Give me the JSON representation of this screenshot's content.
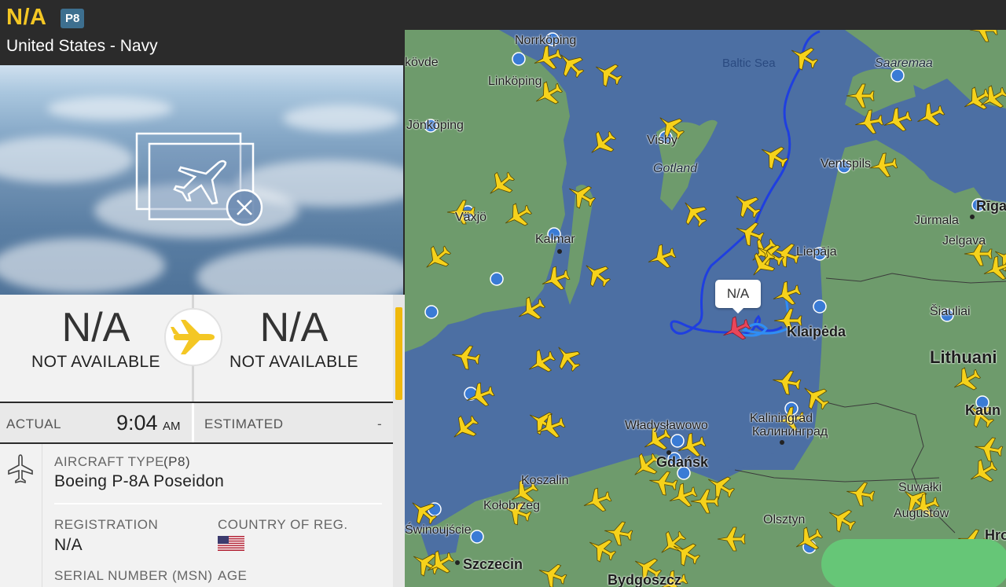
{
  "flight": {
    "callsign": "N/A",
    "aircraft_code": "P8",
    "operator": "United States - Navy"
  },
  "route": {
    "origin": {
      "code": "N/A",
      "name": "NOT AVAILABLE"
    },
    "destination": {
      "code": "N/A",
      "name": "NOT AVAILABLE"
    }
  },
  "times": {
    "actual_label": "ACTUAL",
    "actual_time": "9:04",
    "actual_ampm": "AM",
    "estimated_label": "ESTIMATED",
    "estimated_value": "-"
  },
  "details": {
    "aircraft_type_label": "AIRCRAFT TYPE",
    "aircraft_type_code": "(P8)",
    "aircraft_type_value": "Boeing P-8A Poseidon",
    "registration_label": "REGISTRATION",
    "registration_value": "N/A",
    "country_label": "COUNTRY OF REG.",
    "serial_label": "SERIAL NUMBER (MSN)",
    "age_label": "AGE"
  },
  "map": {
    "selected_callout": "N/A",
    "labels": {
      "baltic_sea": "Baltic Sea",
      "saaremaa": "Saaremaa",
      "gotland": "Gotland",
      "visby": "Visby",
      "norrkoping": "Norrköping",
      "linkoping": "Linköping",
      "jonkoping": "Jönköping",
      "kovde": "kövde",
      "vaxjo": "Växjö",
      "kalmar": "Kalmar",
      "ventspils": "Ventspils",
      "jurmala": "Jūrmala",
      "riga": "Rīga",
      "jelgava": "Jelgava",
      "liepaja": "Liepāja",
      "klaipeda": "Klaipėda",
      "siauliai": "Šiauliai",
      "lithuania": "Lithuani",
      "kaunas": "Kaun",
      "kaliningrad_lat": "Kaliningrad",
      "kaliningrad_cyr": "Калининград",
      "wladyslawowo": "Władysławowo",
      "gdansk": "Gdańsk",
      "koszalin": "Koszalin",
      "kolobrzeg": "Kołobrzeg",
      "swinoujscie": "Świnoujście",
      "szczecin": "Szczecin",
      "bydgoszcz": "Bydgoszcz",
      "olsztyn": "Olsztyn",
      "suwalki": "Suwałki",
      "augustow": "Augustów",
      "hrodna": "Hrod"
    }
  },
  "colors": {
    "callsign": "#f4c724",
    "badge": "#3d6f8f",
    "track": "#1f3fe0",
    "selected_plane": "#e8465a",
    "plane": "#f6d21b",
    "water": "#4c6fa3",
    "land": "#6e9b6c"
  }
}
